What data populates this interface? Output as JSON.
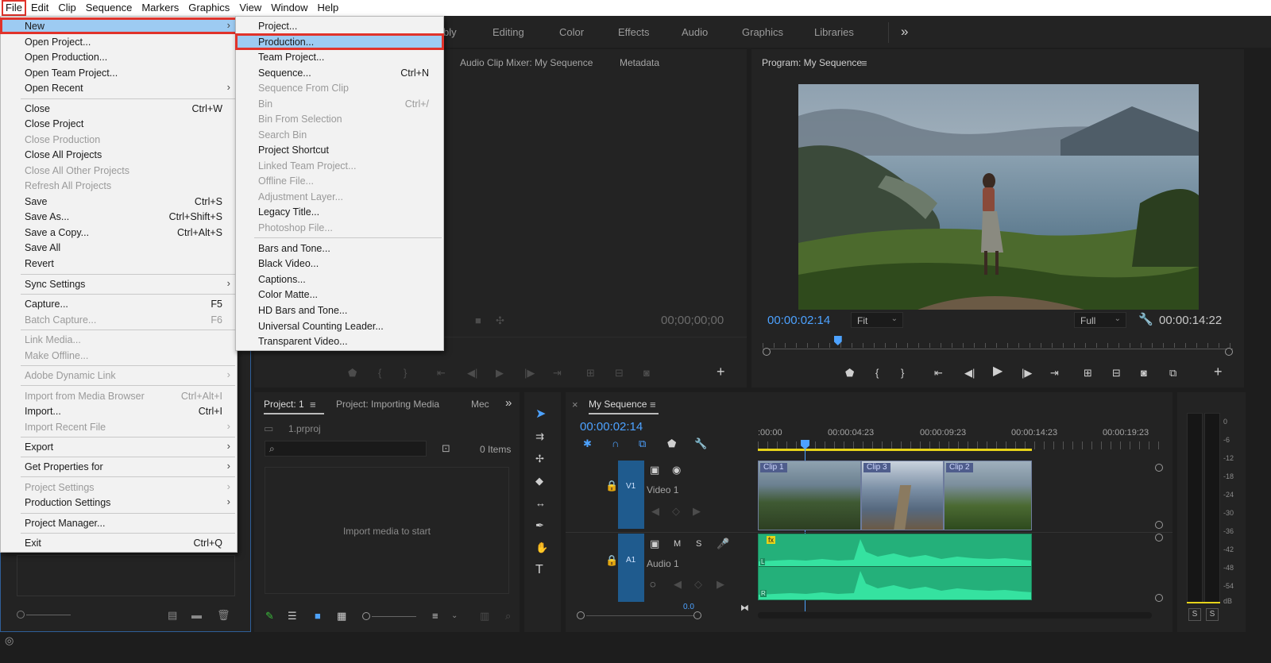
{
  "menubar": {
    "items": [
      "File",
      "Edit",
      "Clip",
      "Sequence",
      "Markers",
      "Graphics",
      "View",
      "Window",
      "Help"
    ]
  },
  "workspaces": [
    "bly",
    "Editing",
    "Color",
    "Effects",
    "Audio",
    "Graphics",
    "Libraries"
  ],
  "more_glyph": "»",
  "source_panel": {
    "tabs": [
      "Audio Clip Mixer: My Sequence",
      "Metadata"
    ],
    "timecode": "00;00;00;00"
  },
  "program": {
    "title": "Program: My Sequence",
    "timecode": "00:00:02:14",
    "fit": "Fit",
    "full": "Full",
    "duration": "00:00:14:22",
    "playhead_fraction": 0.16
  },
  "project": {
    "tabs": [
      "Project: 1",
      "Project: Importing Media",
      "Mec"
    ],
    "file": "1.prproj",
    "items": "0 Items",
    "empty": "Import media to start"
  },
  "timeline": {
    "title": "My Sequence",
    "timecode": "00:00:02:14",
    "ruler": [
      ":00:00",
      "00:00:04:23",
      "00:00:09:23",
      "00:00:14:23",
      "00:00:19:23"
    ],
    "v1": {
      "label": "V1",
      "name": "Video 1"
    },
    "a1": {
      "label": "A1",
      "name": "Audio 1",
      "m": "M",
      "s": "S"
    },
    "clips": [
      "Clip 1",
      "Clip 3",
      "Clip 2"
    ],
    "fx": "fx",
    "ch_l": "L",
    "ch_r": "R",
    "zero": "0.0"
  },
  "vu": {
    "scale": [
      "0",
      "-6",
      "-12",
      "-18",
      "-24",
      "-30",
      "-36",
      "-42",
      "-48",
      "-54",
      "dB"
    ],
    "solo": [
      "S",
      "S"
    ]
  },
  "file_menu": {
    "items": [
      {
        "label": "New",
        "shortcut": "",
        "arrow": true,
        "state": "highlight"
      },
      {
        "label": "Open Project...",
        "shortcut": ""
      },
      {
        "label": "Open Production...",
        "shortcut": ""
      },
      {
        "label": "Open Team Project...",
        "shortcut": ""
      },
      {
        "label": "Open Recent",
        "shortcut": "",
        "arrow": true
      },
      {
        "label": "Close",
        "shortcut": "Ctrl+W"
      },
      {
        "label": "Close Project",
        "shortcut": ""
      },
      {
        "label": "Close Production",
        "shortcut": "",
        "state": "disabled"
      },
      {
        "label": "Close All Projects",
        "shortcut": ""
      },
      {
        "label": "Close All Other Projects",
        "shortcut": "",
        "state": "disabled"
      },
      {
        "label": "Refresh All Projects",
        "shortcut": "",
        "state": "disabled"
      },
      {
        "label": "Save",
        "shortcut": "Ctrl+S"
      },
      {
        "label": "Save As...",
        "shortcut": "Ctrl+Shift+S"
      },
      {
        "label": "Save a Copy...",
        "shortcut": "Ctrl+Alt+S"
      },
      {
        "label": "Save All",
        "shortcut": ""
      },
      {
        "label": "Revert",
        "shortcut": ""
      },
      {
        "label": "Sync Settings",
        "shortcut": "",
        "arrow": true
      },
      {
        "label": "Capture...",
        "shortcut": "F5"
      },
      {
        "label": "Batch Capture...",
        "shortcut": "F6",
        "state": "disabled"
      },
      {
        "label": "Link Media...",
        "shortcut": "",
        "state": "disabled"
      },
      {
        "label": "Make Offline...",
        "shortcut": "",
        "state": "disabled"
      },
      {
        "label": "Adobe Dynamic Link",
        "shortcut": "",
        "arrow": true,
        "state": "disabled"
      },
      {
        "label": "Import from Media Browser",
        "shortcut": "Ctrl+Alt+I",
        "state": "disabled"
      },
      {
        "label": "Import...",
        "shortcut": "Ctrl+I"
      },
      {
        "label": "Import Recent File",
        "shortcut": "",
        "arrow": true,
        "state": "disabled"
      },
      {
        "label": "Export",
        "shortcut": "",
        "arrow": true
      },
      {
        "label": "Get Properties for",
        "shortcut": "",
        "arrow": true
      },
      {
        "label": "Project Settings",
        "shortcut": "",
        "arrow": true,
        "state": "disabled"
      },
      {
        "label": "Production Settings",
        "shortcut": "",
        "arrow": true
      },
      {
        "label": "Project Manager...",
        "shortcut": ""
      },
      {
        "label": "Exit",
        "shortcut": "Ctrl+Q"
      }
    ]
  },
  "new_menu": {
    "items": [
      {
        "label": "Project...",
        "shortcut": ""
      },
      {
        "label": "Production...",
        "shortcut": "",
        "state": "highlight"
      },
      {
        "label": "Team Project...",
        "shortcut": ""
      },
      {
        "label": "Sequence...",
        "shortcut": "Ctrl+N"
      },
      {
        "label": "Sequence From Clip",
        "shortcut": "",
        "state": "disabled"
      },
      {
        "label": "Bin",
        "shortcut": "Ctrl+/",
        "state": "disabled"
      },
      {
        "label": "Bin From Selection",
        "shortcut": "",
        "state": "disabled"
      },
      {
        "label": "Search Bin",
        "shortcut": "",
        "state": "disabled"
      },
      {
        "label": "Project Shortcut",
        "shortcut": ""
      },
      {
        "label": "Linked Team Project...",
        "shortcut": "",
        "state": "disabled"
      },
      {
        "label": "Offline File...",
        "shortcut": "",
        "state": "disabled"
      },
      {
        "label": "Adjustment Layer...",
        "shortcut": "",
        "state": "disabled"
      },
      {
        "label": "Legacy Title...",
        "shortcut": ""
      },
      {
        "label": "Photoshop File...",
        "shortcut": "",
        "state": "disabled"
      },
      {
        "label": "Bars and Tone...",
        "shortcut": ""
      },
      {
        "label": "Black Video...",
        "shortcut": ""
      },
      {
        "label": "Captions...",
        "shortcut": ""
      },
      {
        "label": "Color Matte...",
        "shortcut": ""
      },
      {
        "label": "HD Bars and Tone...",
        "shortcut": ""
      },
      {
        "label": "Universal Counting Leader...",
        "shortcut": ""
      },
      {
        "label": "Transparent Video...",
        "shortcut": ""
      }
    ]
  },
  "colors": {
    "accent_blue": "#4da2ff",
    "highlight_box": "#e0332b",
    "menu_highlight": "#9dcbf2",
    "audio_wave": "#2fd08f",
    "track_header": "#1f5b8e"
  }
}
